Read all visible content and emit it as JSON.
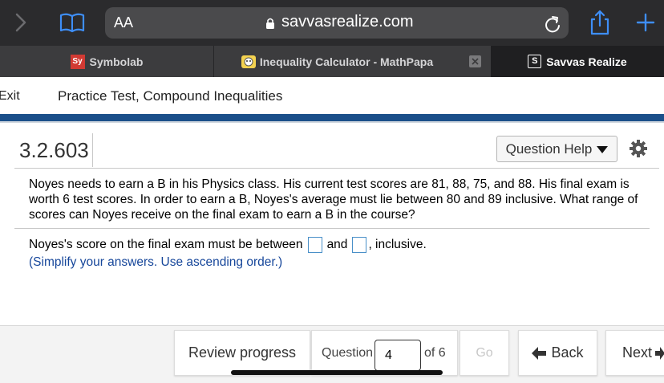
{
  "browser": {
    "text_size_label": "AA",
    "url": "savvasrealize.com",
    "tabs": [
      {
        "label": "Symbolab",
        "favicon_text": "Sy"
      },
      {
        "label": "Inequality Calculator - MathPapa",
        "favicon_text": ""
      },
      {
        "label": "Savvas Realize",
        "favicon_text": "S"
      }
    ]
  },
  "header": {
    "exit_label": "Exit",
    "title": "Practice Test, Compound Inequalities"
  },
  "question": {
    "number": "3.2.603",
    "help_label": "Question Help",
    "problem_text": "Noyes needs to earn a B in his Physics class. His current test scores are 81, 88, 75, and 88. His final exam is worth 6 test scores. In order to earn a B, Noyes's average must lie between 80 and 89 inclusive. What range of scores can Noyes receive on the final exam to earn a B in the course?",
    "answer_prefix": "Noyes's score on the final exam must be between",
    "answer_middle": "and",
    "answer_suffix": ", inclusive.",
    "instructions": "(Simplify your answers. Use ascending order.)",
    "answer1_value": "",
    "answer2_value": ""
  },
  "footer": {
    "review_label": "Review progress",
    "question_label": "Question",
    "question_value": "4",
    "of_label": "of 6",
    "go_label": "Go",
    "back_label": "Back",
    "next_label": "Next"
  },
  "colors": {
    "accent_blue": "#1b4f8a",
    "instruction_blue": "#16469a",
    "safari_dark": "#2b2b2d"
  }
}
